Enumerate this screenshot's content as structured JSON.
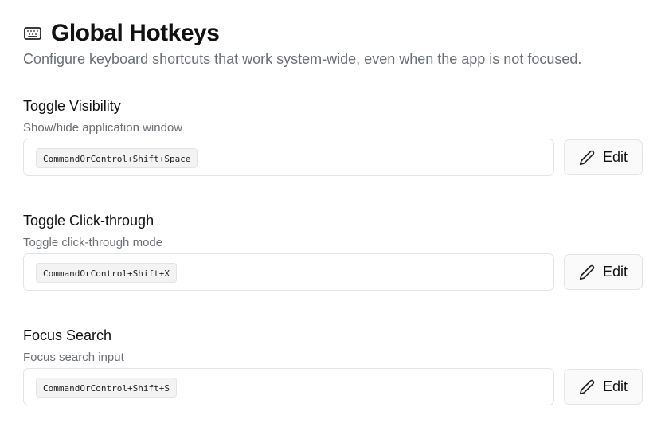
{
  "header": {
    "icon": "keyboard-icon",
    "title": "Global Hotkeys",
    "subtitle": "Configure keyboard shortcuts that work system-wide, even when the app is not focused."
  },
  "hotkeys": [
    {
      "title": "Toggle Visibility",
      "description": "Show/hide application window",
      "shortcut": "CommandOrControl+Shift+Space",
      "edit_label": "Edit",
      "edit_icon": "pencil-icon"
    },
    {
      "title": "Toggle Click-through",
      "description": "Toggle click-through mode",
      "shortcut": "CommandOrControl+Shift+X",
      "edit_label": "Edit",
      "edit_icon": "pencil-icon"
    },
    {
      "title": "Focus Search",
      "description": "Focus search input",
      "shortcut": "CommandOrControl+Shift+S",
      "edit_label": "Edit",
      "edit_icon": "pencil-icon"
    }
  ]
}
